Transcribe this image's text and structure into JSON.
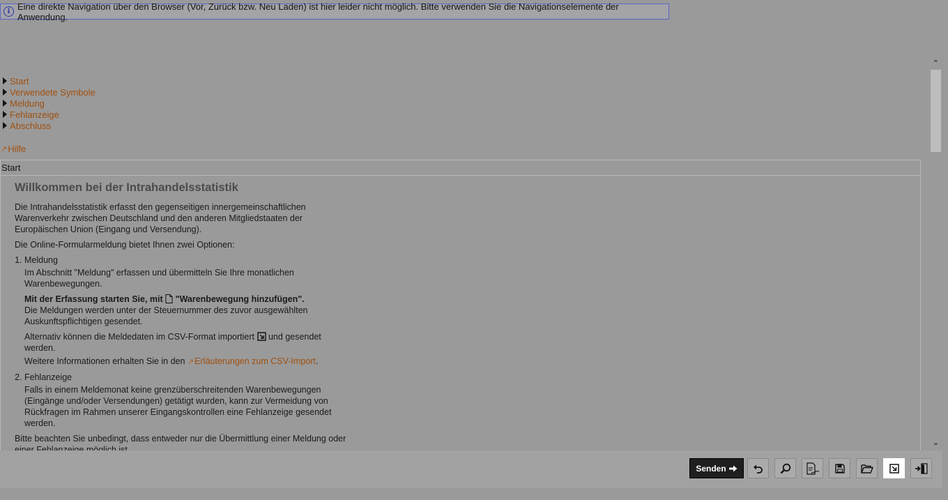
{
  "banner": {
    "text": "Eine direkte Navigation über den Browser (Vor, Zurück bzw. Neu Laden) ist hier leider nicht möglich. Bitte verwenden Sie die Navigationselemente der Anwendung."
  },
  "nav": {
    "items": [
      {
        "label": "Start"
      },
      {
        "label": "Verwendete Symbole"
      },
      {
        "label": "Meldung"
      },
      {
        "label": "Fehlanzeige"
      },
      {
        "label": "Abschluss"
      }
    ],
    "help": "Hilfe"
  },
  "panel": {
    "header": "Start",
    "title": "Willkommen bei der Intrahandelsstatistik",
    "intro": "Die Intrahandelsstatistik erfasst den gegenseitigen innergemeinschaftlichen Warenverkehr zwischen Deutschland und den anderen Mitgliedstaaten der Europäischen Union (Eingang und Versendung).",
    "options_intro": "Die Online-Formularmeldung bietet Ihnen zwei Optionen:",
    "opt1": {
      "head": "Meldung",
      "text1": "Im Abschnitt \"Meldung\" erfassen und übermitteln Sie Ihre monatlichen Warenbewegungen.",
      "bold_a": "Mit der Erfassung starten Sie, mit",
      "bold_b": "\"Warenbewegung hinzufügen\".",
      "text2": "Die Meldungen werden unter der Steuernummer des zuvor ausgewählten Auskunftspflichtigen gesendet.",
      "alt_a": "Alternativ können die Meldedaten im CSV-Format importiert",
      "alt_b": "und gesendet werden.",
      "more_a": "Weitere Informationen erhalten Sie in den",
      "more_link": "Erläuterungen zum CSV-Import",
      "more_b": "."
    },
    "opt2": {
      "head": "Fehlanzeige",
      "text": "Falls in einem Meldemonat keine grenzüberschreitenden Warenbewegungen (Eingänge und/oder Versendungen) getätigt wurden, kann zur Vermeidung von Rückfragen im Rahmen unserer Eingangskontrollen eine Fehlanzeige gesendet werden."
    },
    "note": "Bitte beachten Sie unbedingt, dass entweder nur die Übermittlung einer Meldung oder einer Fehlanzeige möglich ist."
  },
  "toolbar": {
    "send_label": "Senden",
    "icons": [
      "undo-icon",
      "search-icon",
      "document-edit-icon",
      "save-icon",
      "folder-open-icon",
      "import-icon",
      "exit-icon"
    ]
  },
  "colors": {
    "link": "#a0500f",
    "send_bg": "#1f1f1f"
  }
}
